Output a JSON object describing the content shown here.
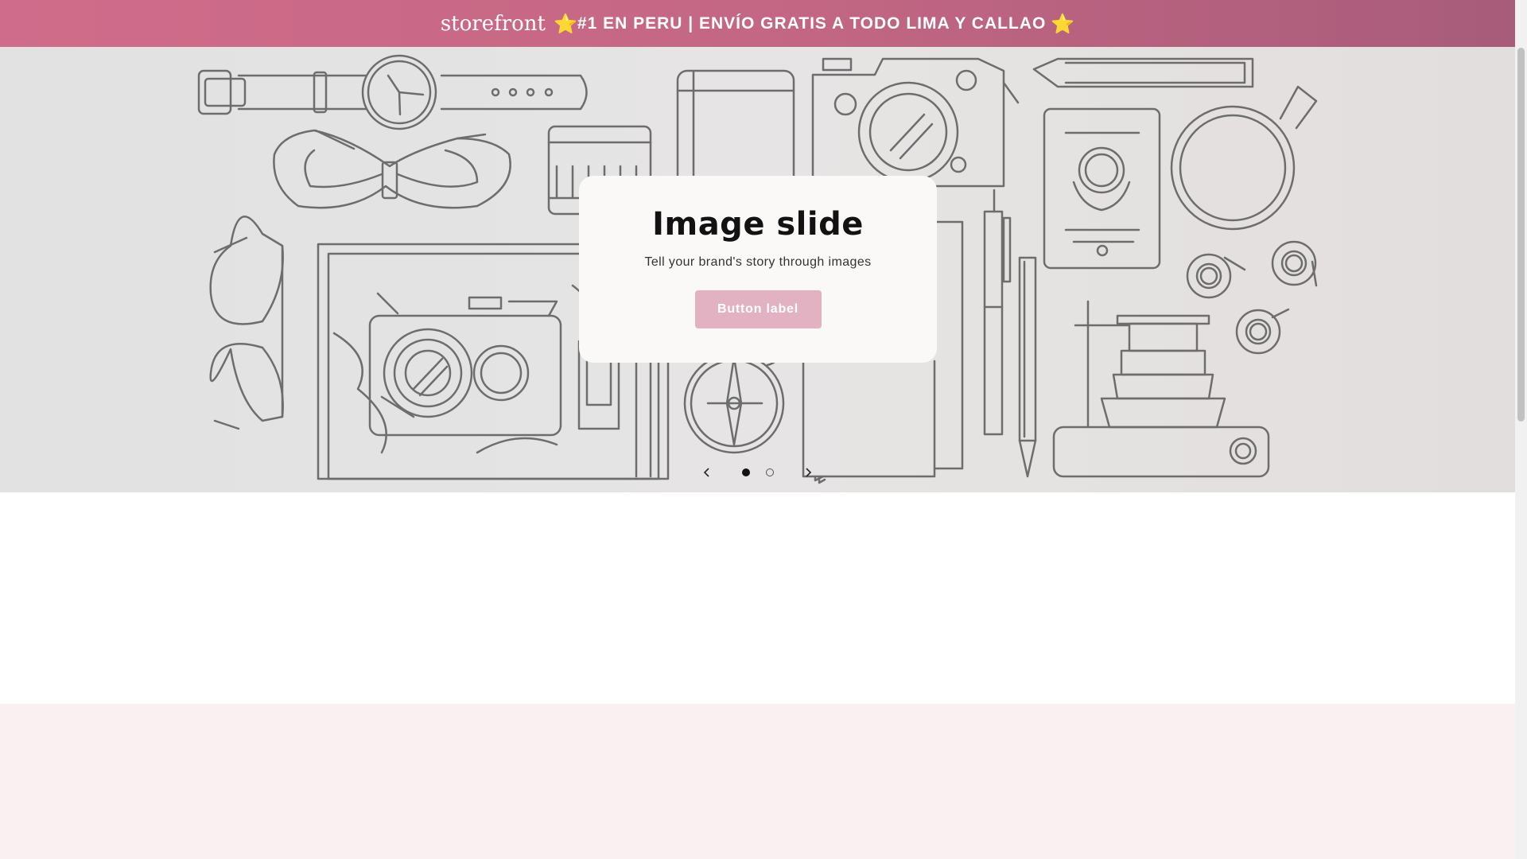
{
  "announcement": {
    "brand": "storefront",
    "star_icon": "⭐",
    "message": "#1 EN PERU | ENVÍO GRATIS A TODO LIMA Y CALLAO"
  },
  "slideshow": {
    "title": "Image slide",
    "text": "Tell your brand's story through images",
    "button_label": "Button label",
    "current_slide": 1,
    "total_slides": 2
  },
  "colors": {
    "announcement_bar": "#c46784",
    "button": "#e3b2c2",
    "pink_section": "#faf0f1",
    "illustration_stroke": "#6d6d6d"
  }
}
